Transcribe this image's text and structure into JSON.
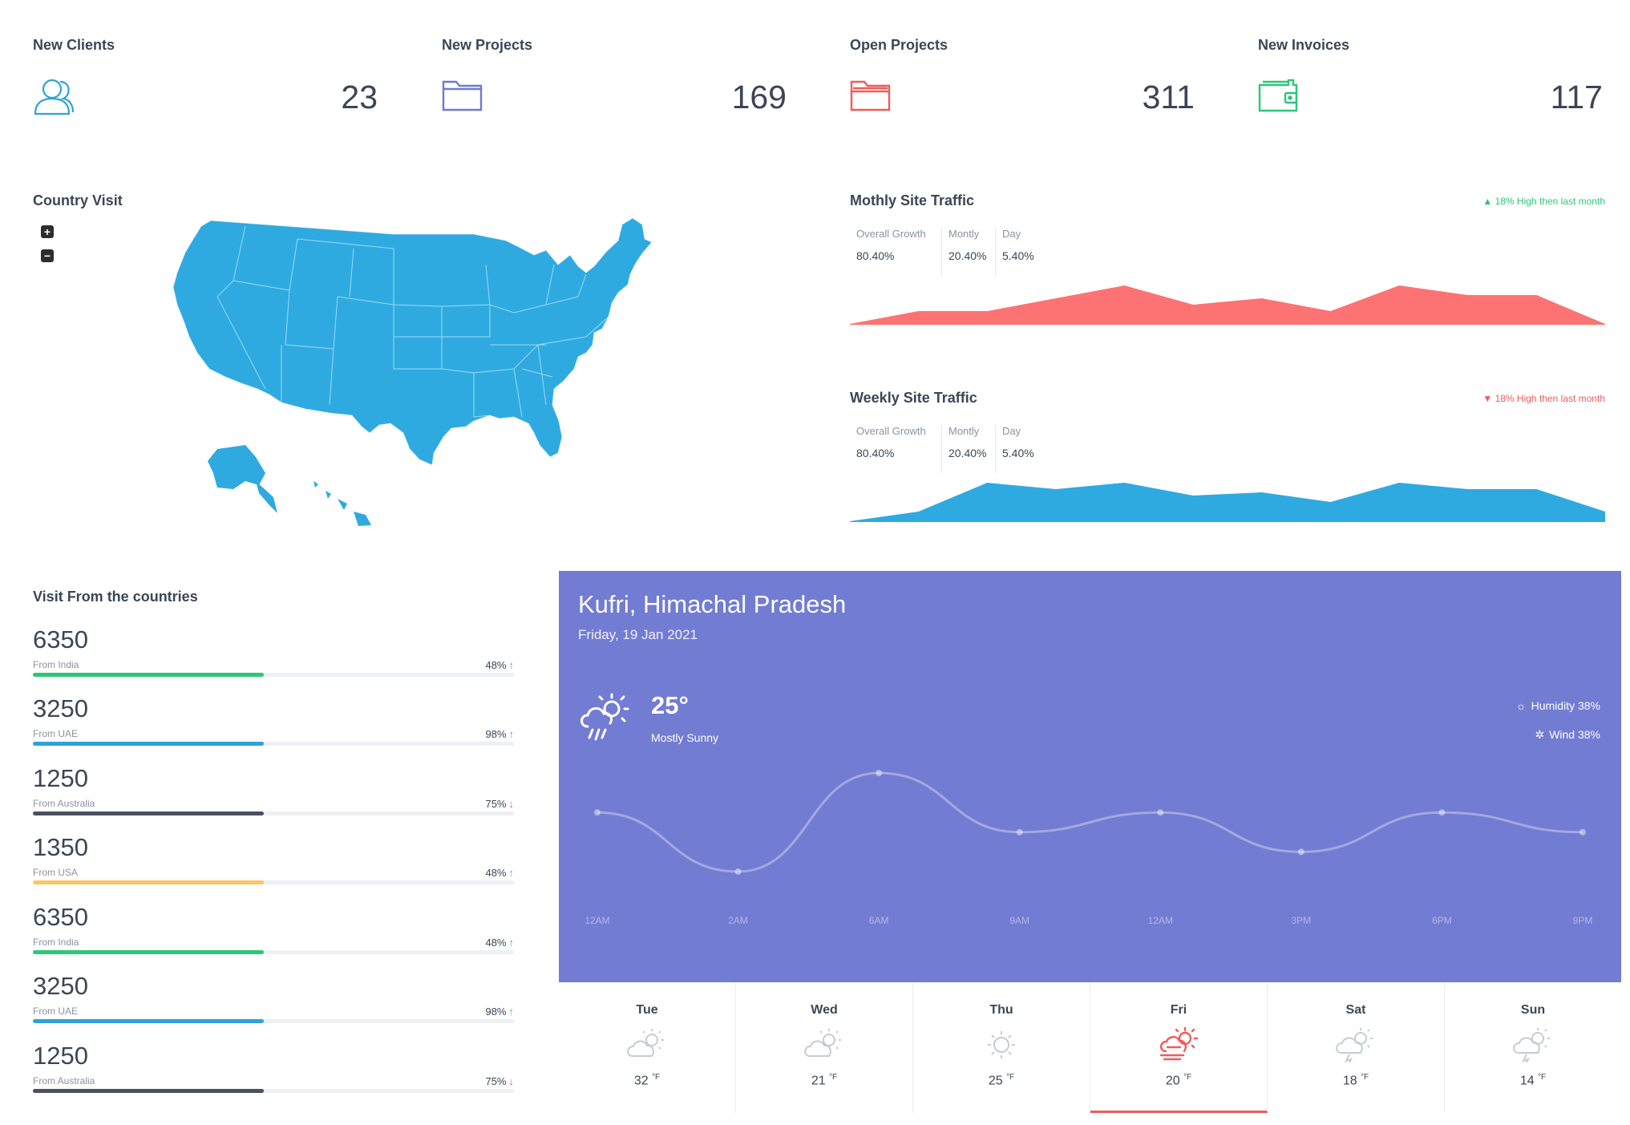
{
  "stats": [
    {
      "title": "New Clients",
      "value": "23",
      "icon": "user-icon",
      "color": "#2ea3d8"
    },
    {
      "title": "New Projects",
      "value": "169",
      "icon": "folder-icon",
      "color": "#6f7bd0"
    },
    {
      "title": "Open Projects",
      "value": "311",
      "icon": "folder-open-icon",
      "color": "#f15a5a"
    },
    {
      "title": "New Invoices",
      "value": "117",
      "icon": "wallet-icon",
      "color": "#2dc67a"
    }
  ],
  "country_visit": {
    "title": "Country Visit",
    "zoom_in": "+",
    "zoom_out": "−",
    "map_color": "#2eaae1"
  },
  "monthly_traffic": {
    "title": "Mothly Site Traffic",
    "badge": "18% High then last month",
    "badge_direction": "up",
    "badge_color": "#2dc67a",
    "area_color": "#fd7272",
    "metrics": [
      {
        "label": "Overall Growth",
        "value": "80.40%"
      },
      {
        "label": "Montly",
        "value": "20.40%"
      },
      {
        "label": "Day",
        "value": "5.40%"
      }
    ],
    "series": [
      0,
      4,
      4,
      8,
      12,
      6,
      8,
      4,
      12,
      9,
      9,
      0
    ]
  },
  "weekly_traffic": {
    "title": "Weekly Site Traffic",
    "badge": "18% High then last month",
    "badge_direction": "down",
    "badge_color": "#f15a5a",
    "area_color": "#2eaae1",
    "metrics": [
      {
        "label": "Overall Growth",
        "value": "80.40%"
      },
      {
        "label": "Montly",
        "value": "20.40%"
      },
      {
        "label": "Day",
        "value": "5.40%"
      }
    ],
    "series": [
      0,
      3,
      12,
      10,
      12,
      8,
      9,
      6,
      12,
      10,
      10,
      3
    ]
  },
  "countries": {
    "title": "Visit From the countries",
    "items": [
      {
        "value": "6350",
        "label": "From India",
        "pct": "48%",
        "trend": "up",
        "fill": 0.48,
        "color": "#2dc67a"
      },
      {
        "value": "3250",
        "label": "From UAE",
        "pct": "98%",
        "trend": "up",
        "fill": 0.48,
        "color": "#2ea3d8"
      },
      {
        "value": "1250",
        "label": "From Australia",
        "pct": "75%",
        "trend": "down",
        "fill": 0.48,
        "color": "#4a5160"
      },
      {
        "value": "1350",
        "label": "From USA",
        "pct": "48%",
        "trend": "up",
        "fill": 0.48,
        "color": "#fdc55f"
      },
      {
        "value": "6350",
        "label": "From India",
        "pct": "48%",
        "trend": "up",
        "fill": 0.48,
        "color": "#2dc67a"
      },
      {
        "value": "3250",
        "label": "From UAE",
        "pct": "98%",
        "trend": "up",
        "fill": 0.48,
        "color": "#2ea3d8"
      },
      {
        "value": "1250",
        "label": "From Australia",
        "pct": "75%",
        "trend": "down",
        "fill": 0.48,
        "color": "#4a5160"
      }
    ]
  },
  "weather": {
    "city": "Kufri, Himachal Pradesh",
    "date": "Friday, 19 Jan 2021",
    "temp": "25°",
    "condition": "Mostly Sunny",
    "humidity": "Humidity 38%",
    "wind": "Wind 38%",
    "card_color": "#727cd2",
    "hours": [
      "12AM",
      "2AM",
      "6AM",
      "9AM",
      "12AM",
      "3PM",
      "6PM",
      "9PM"
    ],
    "hourly_values": [
      3,
      0,
      5,
      2,
      3,
      1,
      3,
      2
    ],
    "days": [
      {
        "name": "Tue",
        "temp": "32",
        "unit": "°F",
        "icon": "cloud-sun-icon",
        "active": false
      },
      {
        "name": "Wed",
        "temp": "21",
        "unit": "°F",
        "icon": "cloud-sun-icon",
        "active": false
      },
      {
        "name": "Thu",
        "temp": "25",
        "unit": "°F",
        "icon": "sun-icon",
        "active": false
      },
      {
        "name": "Fri",
        "temp": "20",
        "unit": "°F",
        "icon": "windy-sun-icon",
        "active": true
      },
      {
        "name": "Sat",
        "temp": "18",
        "unit": "°F",
        "icon": "cloud-storm-icon",
        "active": false
      },
      {
        "name": "Sun",
        "temp": "14",
        "unit": "°F",
        "icon": "cloud-storm-icon",
        "active": false
      }
    ]
  }
}
